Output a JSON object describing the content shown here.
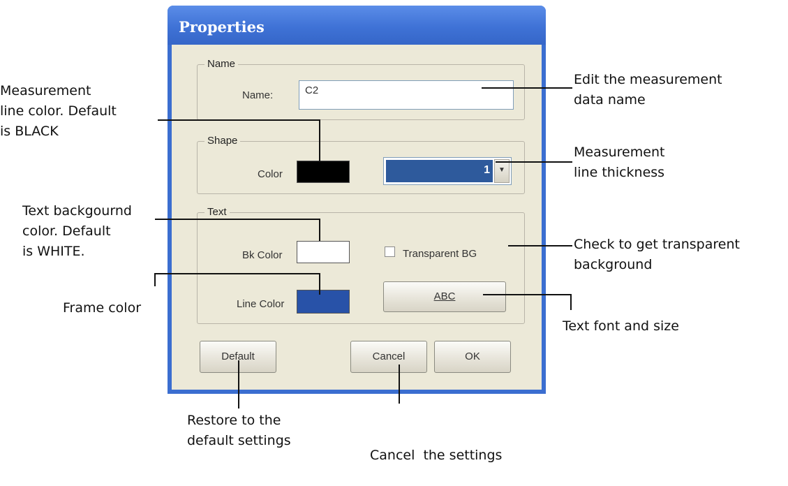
{
  "dialog": {
    "title": "Properties",
    "name_group": {
      "legend": "Name",
      "label": "Name:",
      "value": "C2"
    },
    "shape_group": {
      "legend": "Shape",
      "color_label": "Color",
      "thickness_value": "1",
      "color_value": "#000000"
    },
    "text_group": {
      "legend": "Text",
      "bk_color_label": "Bk Color",
      "bk_color_value": "#ffffff",
      "transparent_label": "Transparent BG",
      "transparent_checked": false,
      "line_color_label": "Line Color",
      "line_color_value": "#2852a8",
      "font_button": "ABC"
    },
    "buttons": {
      "default": "Default",
      "cancel": "Cancel",
      "ok": "OK"
    }
  },
  "annotations": {
    "name_edit": [
      "Edit the measurement",
      "data name"
    ],
    "line_color": [
      "Measurement",
      "line color. Default",
      "is BLACK"
    ],
    "thickness": [
      "Measurement",
      "line thickness"
    ],
    "text_bg": [
      "Text backgournd",
      "color. Default",
      "is WHITE."
    ],
    "transparent": [
      "Check to get transparent",
      "background"
    ],
    "frame_color": [
      "Frame color"
    ],
    "font": [
      "Text font and size"
    ],
    "restore": [
      "Restore to the",
      "default settings"
    ],
    "cancel": [
      "Cancel  the settings"
    ]
  },
  "colors": {
    "titlebar": "#3f72d6",
    "dialog_bg": "#ece9d8",
    "combo_selection": "#2e5a9c"
  }
}
